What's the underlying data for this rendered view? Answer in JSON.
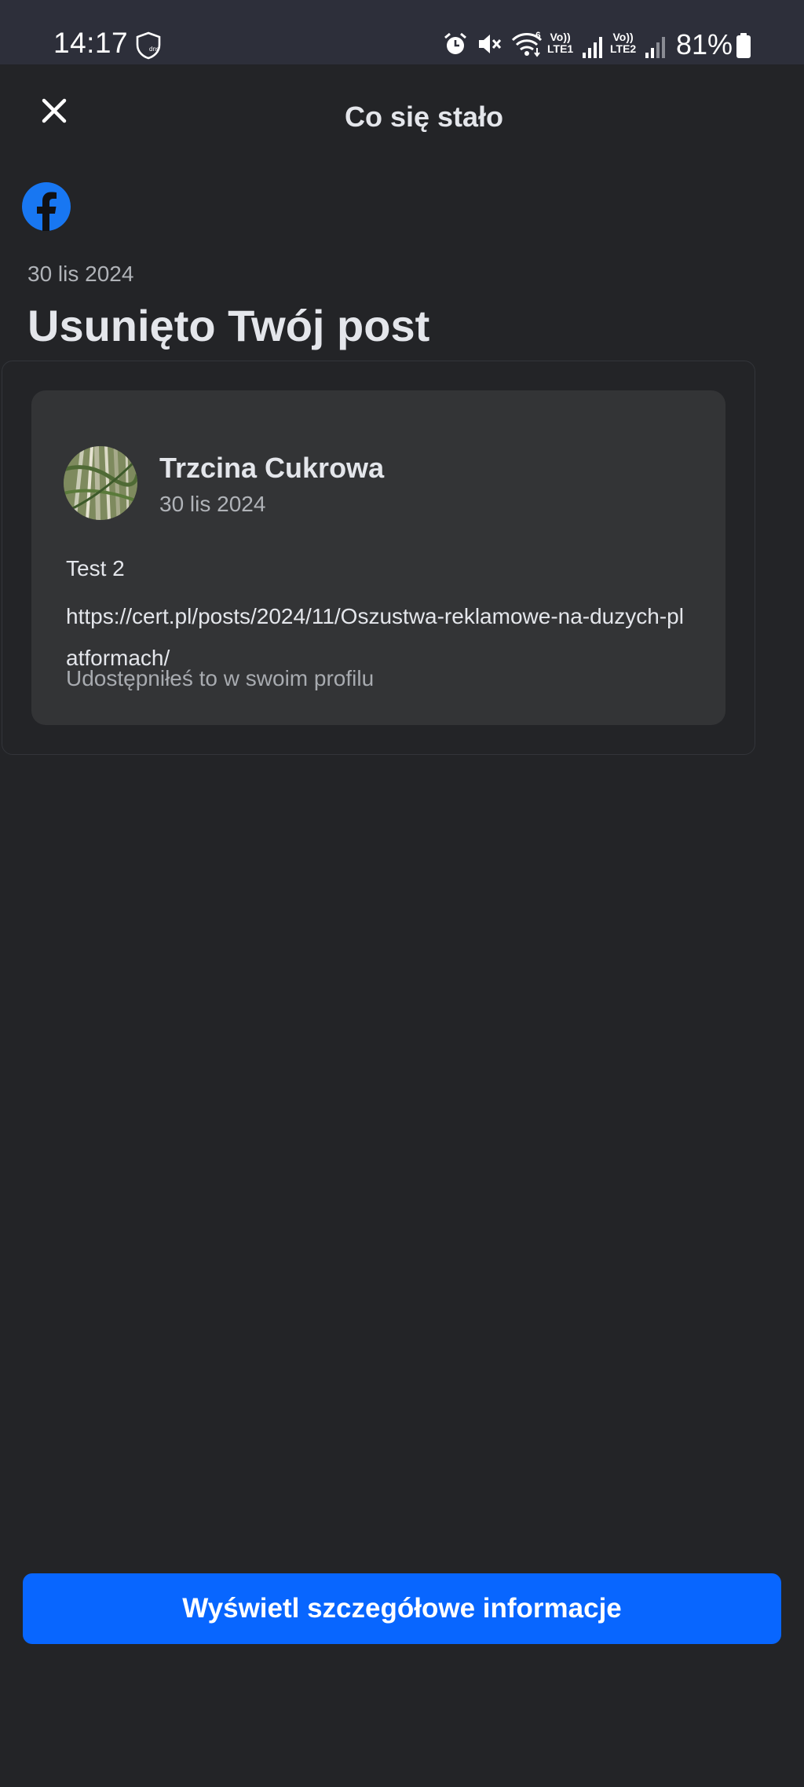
{
  "status_bar": {
    "time": "14:17",
    "battery": "81%",
    "sim1_label_top": "Vo))",
    "sim1_label_bottom": "LTE1",
    "sim2_label_top": "Vo))",
    "sim2_label_bottom": "LTE2",
    "wifi_badge": "6",
    "vpn_badge": "dns"
  },
  "header": {
    "title": "Co się stało",
    "close_icon": "close-icon"
  },
  "notice": {
    "date": "30 lis 2024",
    "heading": "Usunięto Twój post",
    "brand_icon": "facebook-icon",
    "brand_color": "#1877f2"
  },
  "post": {
    "author": "Trzcina Cukrowa",
    "date": "30 lis 2024",
    "text": "Test 2",
    "link": "https://cert.pl/posts/2024/11/Oszustwa-reklamowe-na-duzych-platformach/",
    "shared_note": "Udostępniłeś to w swoim profilu"
  },
  "actions": {
    "details_button": "Wyświetl szczegółowe informacje",
    "accent_color": "#0866ff"
  }
}
